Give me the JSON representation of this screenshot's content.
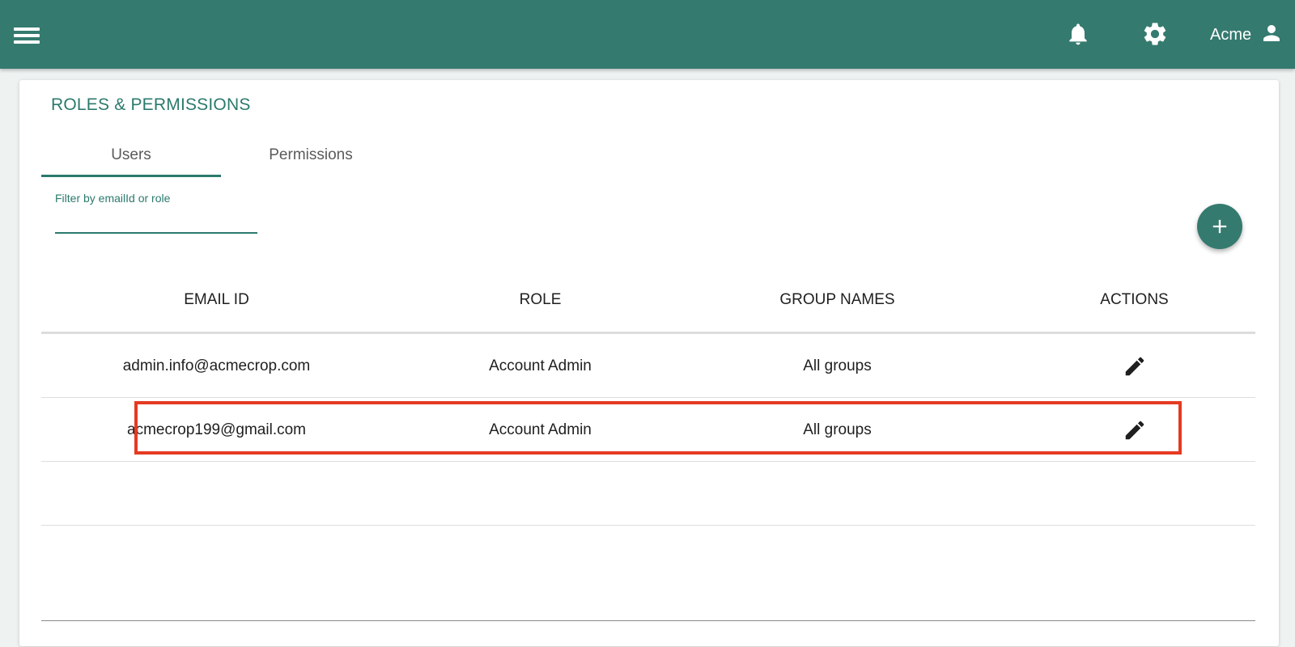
{
  "header": {
    "user_name": "Acme",
    "accent_color": "#357a6f",
    "icons": [
      "menu-icon",
      "bell-icon",
      "gear-icon",
      "person-icon"
    ]
  },
  "page": {
    "title": "ROLES & PERMISSIONS",
    "tabs": [
      {
        "label": "Users",
        "active": true
      },
      {
        "label": "Permissions",
        "active": false
      }
    ],
    "filter": {
      "label": "Filter by emailId or role",
      "value": ""
    }
  },
  "table": {
    "columns": [
      "EMAIL ID",
      "ROLE",
      "GROUP NAMES",
      "ACTIONS"
    ],
    "rows": [
      {
        "email": "admin.info@acmecrop.com",
        "role": "Account Admin",
        "groups": "All groups",
        "action_icon": "edit-icon"
      },
      {
        "email": "acmecrop199@gmail.com",
        "role": "Account Admin",
        "groups": "All groups",
        "action_icon": "edit-icon",
        "highlighted": true
      }
    ],
    "highlight_color": "#e53a22"
  }
}
